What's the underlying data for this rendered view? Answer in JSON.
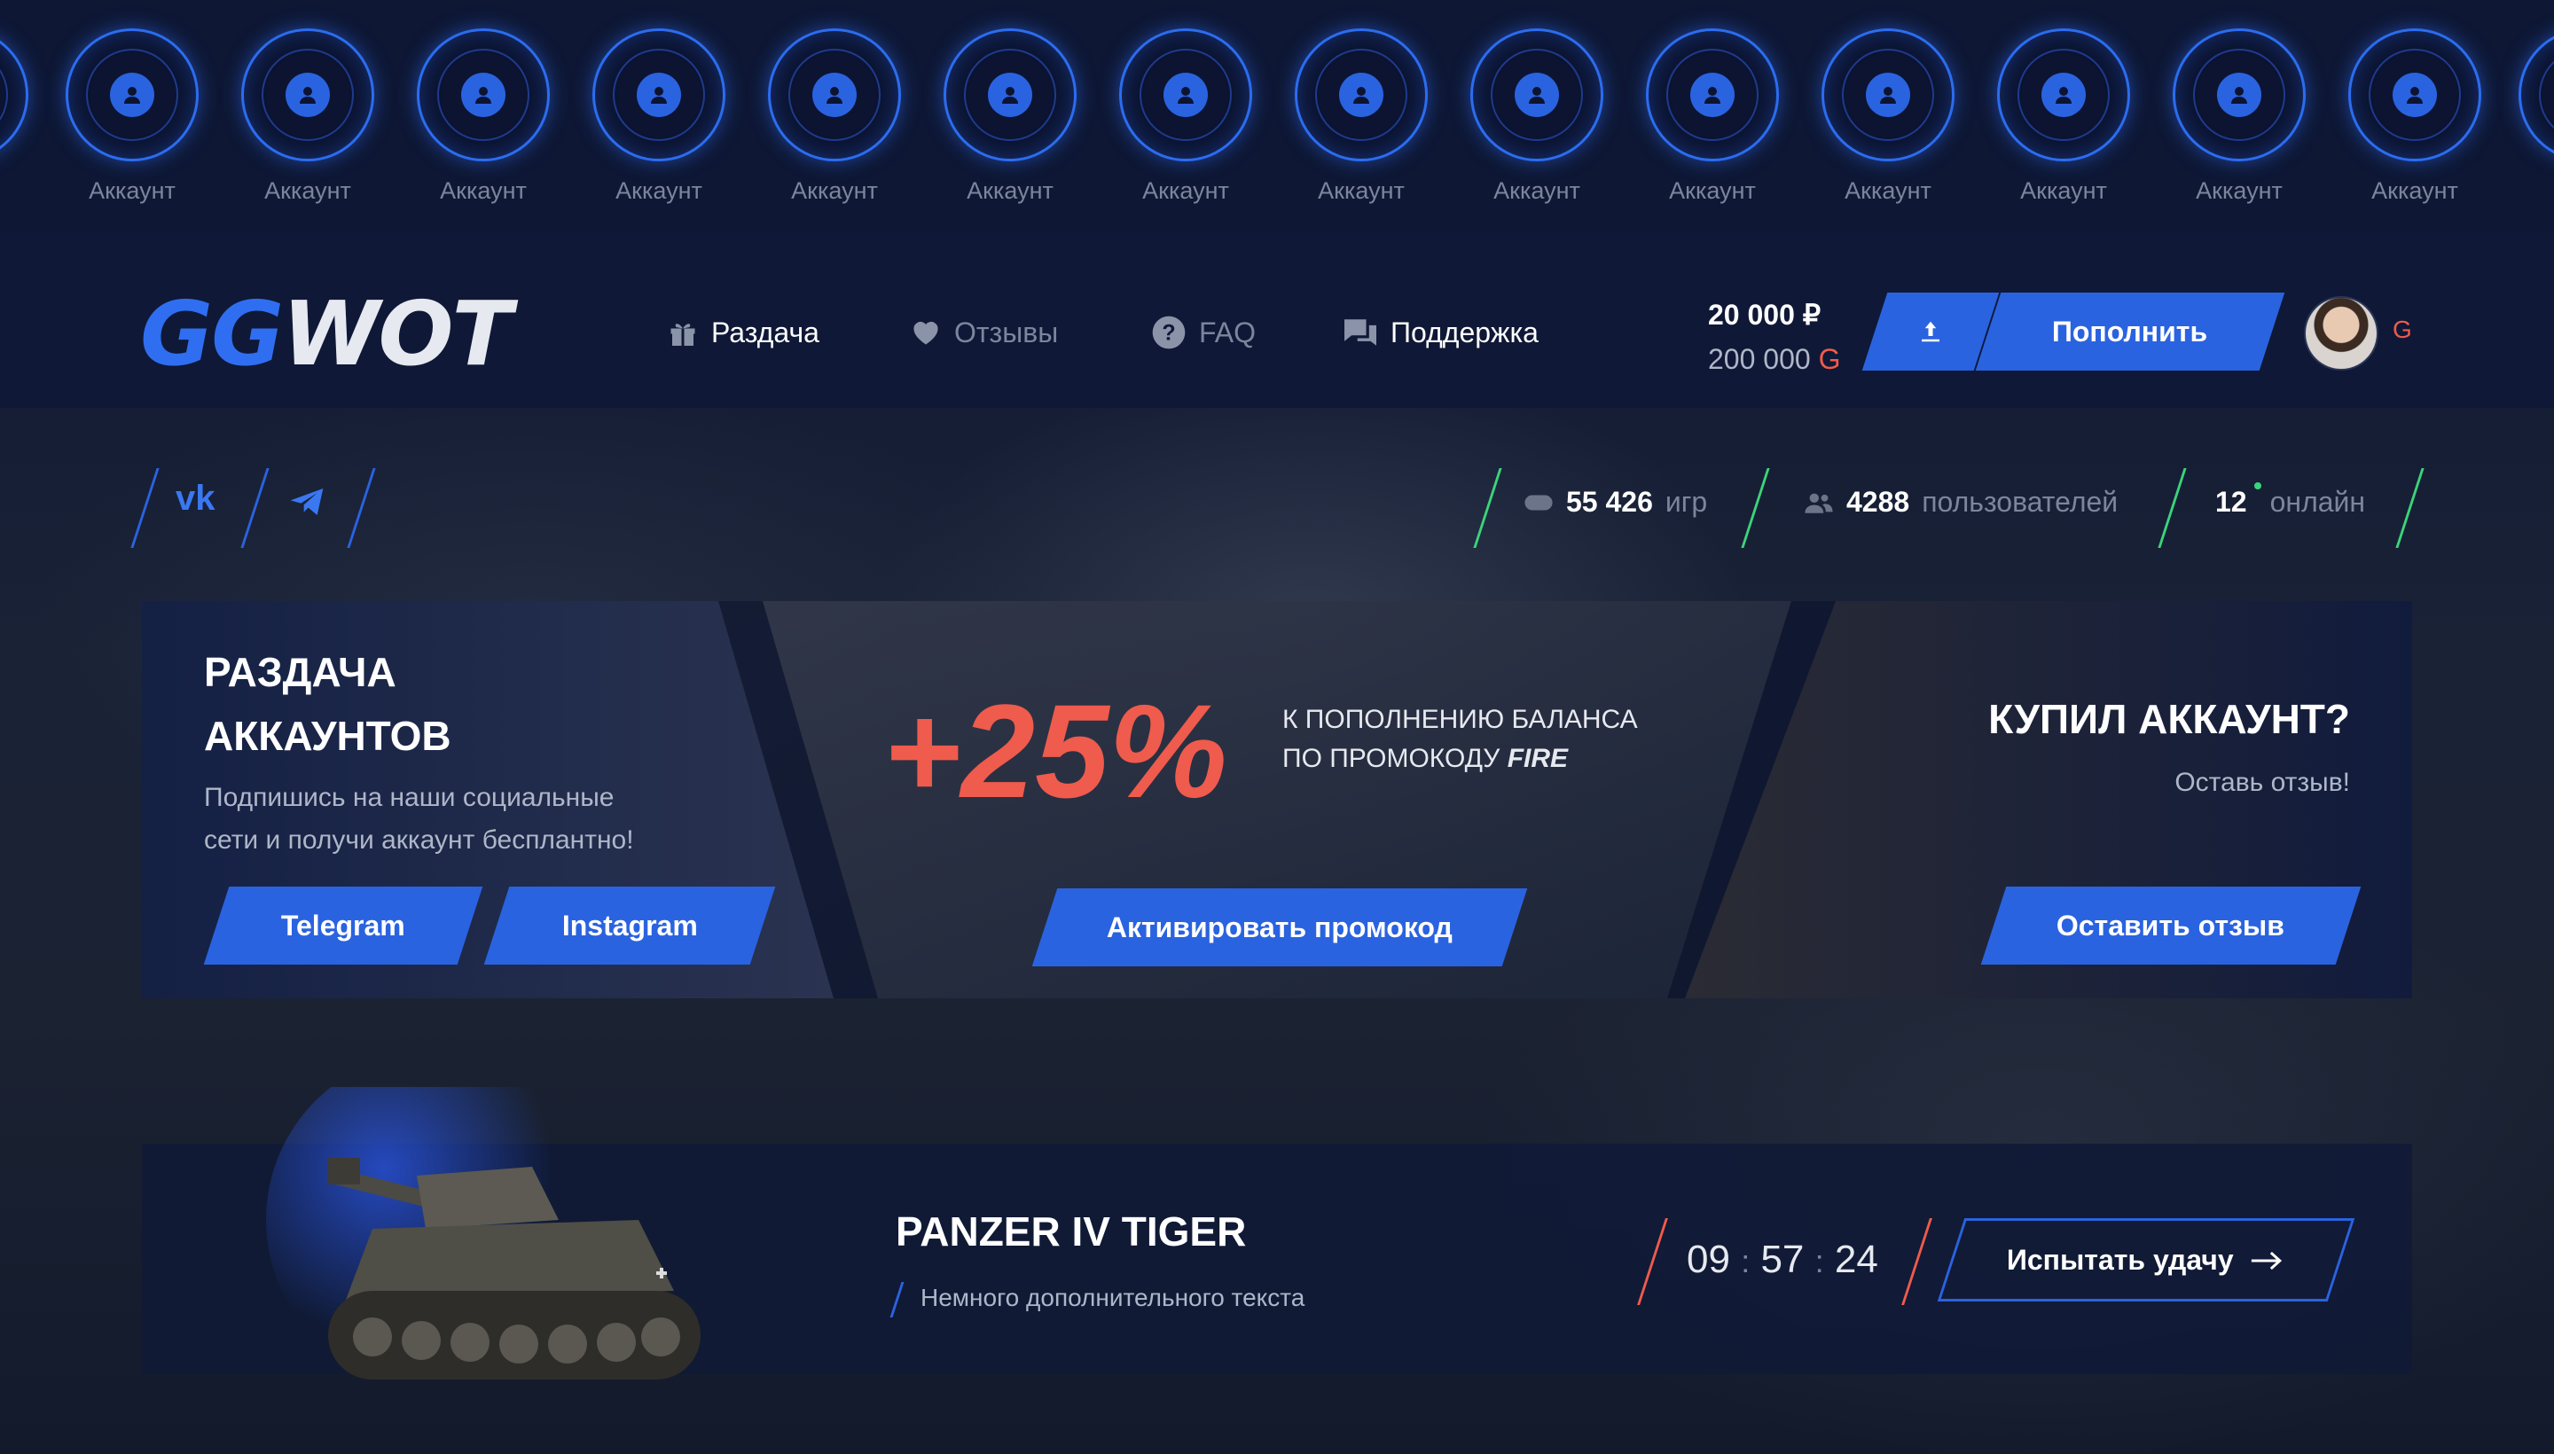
{
  "accounts": {
    "label": "Аккаунт",
    "count": 14
  },
  "logo": {
    "part1": "GG",
    "part2": "WOT"
  },
  "nav": [
    {
      "label": "Раздача",
      "icon": "gift-icon"
    },
    {
      "label": "Отзывы",
      "icon": "heart-icon"
    },
    {
      "label": "FAQ",
      "icon": "question-icon"
    },
    {
      "label": "Поддержка",
      "icon": "chat-icon"
    }
  ],
  "balance": {
    "rub": "20 000 ₽",
    "gold": "200 000",
    "gold_symbol": "G"
  },
  "topup_label": "Пополнить",
  "user_currency": "G",
  "social": {
    "vk": "vk",
    "telegram": "telegram-icon"
  },
  "stats": {
    "games_value": "55 426",
    "games_label": "игр",
    "users_value": "4288",
    "users_label": "пользователей",
    "online_value": "12",
    "online_label": "онлайн"
  },
  "promo": {
    "giveaway_title_1": "РАЗДАЧА",
    "giveaway_title_2": "АККАУНТОВ",
    "giveaway_text_1": "Подпишись на наши социальные",
    "giveaway_text_2": "сети и получи аккаунт бесплантно!",
    "telegram_btn": "Telegram",
    "instagram_btn": "Instagram",
    "bonus_value": "+25%",
    "bonus_text_1": "К ПОПОЛНЕНИЮ БАЛАНСА",
    "bonus_text_2": "ПО ПРОМОКОДУ",
    "bonus_code": "FIRE",
    "activate_btn": "Активировать промокод",
    "review_title": "КУПИЛ АККАУНТ?",
    "review_sub": "Оставь отзыв!",
    "review_btn": "Оставить отзыв"
  },
  "featured": {
    "title": "PANZER IV TIGER",
    "subtitle": "Немного дополнительного текста",
    "timer_h": "09",
    "timer_m": "57",
    "timer_s": "24",
    "try_btn": "Испытать удачу"
  },
  "colors": {
    "accent": "#2a63e0",
    "promo_red": "#ef5b4c",
    "green": "#3bd47a"
  }
}
